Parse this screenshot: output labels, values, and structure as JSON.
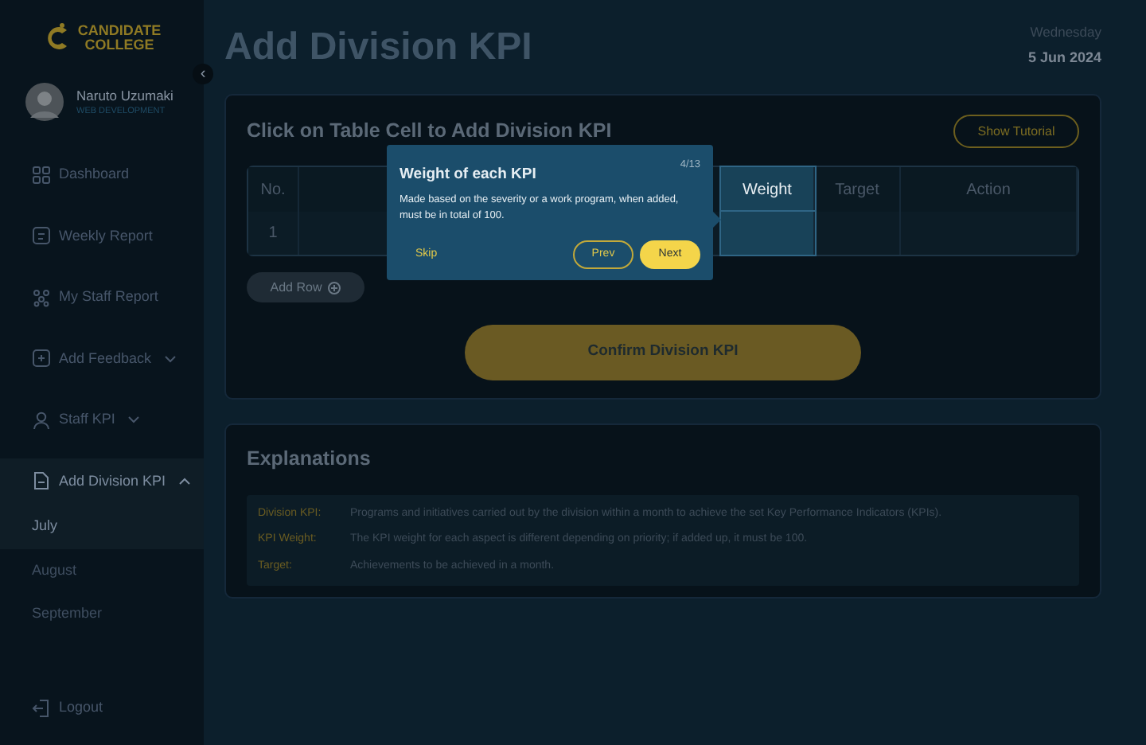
{
  "sidebar": {
    "logo": {
      "line1": "CANDIDATE",
      "line2": "COLLEGE"
    },
    "collapse_icon": "‹",
    "profile": {
      "name": "Naruto Uzumaki",
      "role": "WEB DEVELOPMENT"
    },
    "items": [
      {
        "label": "Dashboard",
        "kind": "grid",
        "selected": false
      },
      {
        "label": "Weekly Report",
        "kind": "report",
        "selected": false
      },
      {
        "label": "My Staff Report",
        "kind": "staff",
        "selected": false
      },
      {
        "label": "Add Feedback",
        "kind": "plus",
        "expanded": false,
        "selected": false
      },
      {
        "label": "Staff KPI",
        "kind": "user",
        "expanded": false,
        "selected": false
      },
      {
        "label": "Add Division KPI",
        "kind": "file",
        "expanded": true,
        "selected": true,
        "children": [
          {
            "label": "July",
            "selected": true
          },
          {
            "label": "August",
            "selected": false
          },
          {
            "label": "September",
            "selected": false
          }
        ]
      }
    ],
    "logout": "Logout"
  },
  "header": {
    "title": "Add Division KPI",
    "weekday": "Wednesday",
    "date": "5 Jun 2024"
  },
  "kpi_card": {
    "title": "Click on Table Cell to Add Division KPI",
    "tutorial_button": "Show Tutorial",
    "table": {
      "columns": [
        {
          "label": "No.",
          "highlighted": false
        },
        {
          "label": "Weight",
          "highlighted": true
        },
        {
          "label": "Target",
          "highlighted": false
        },
        {
          "label": "Action",
          "highlighted": false
        }
      ],
      "rows": [
        [
          "1"
        ]
      ]
    },
    "add_row_button": "Add Row",
    "confirm_button": "Confirm Division KPI"
  },
  "tooltip": {
    "title": "Weight of each KPI",
    "step": "4/13",
    "body": "Made based on the severity or a work program, when added, must be in total of 100.",
    "skip": "Skip",
    "prev": "Prev",
    "next": "Next"
  },
  "explanations": {
    "title": "Explanations",
    "items": [
      {
        "term": "Division KPI:",
        "text": "Programs and initiatives carried out by the division within a month to achieve the set Key Performance Indicators (KPIs)."
      },
      {
        "term": "KPI Weight:",
        "text": "The KPI weight for each aspect is different depending on priority; if added up, it must be 100."
      },
      {
        "term": "Target:",
        "text": "Achievements to be achieved in a month."
      }
    ]
  }
}
